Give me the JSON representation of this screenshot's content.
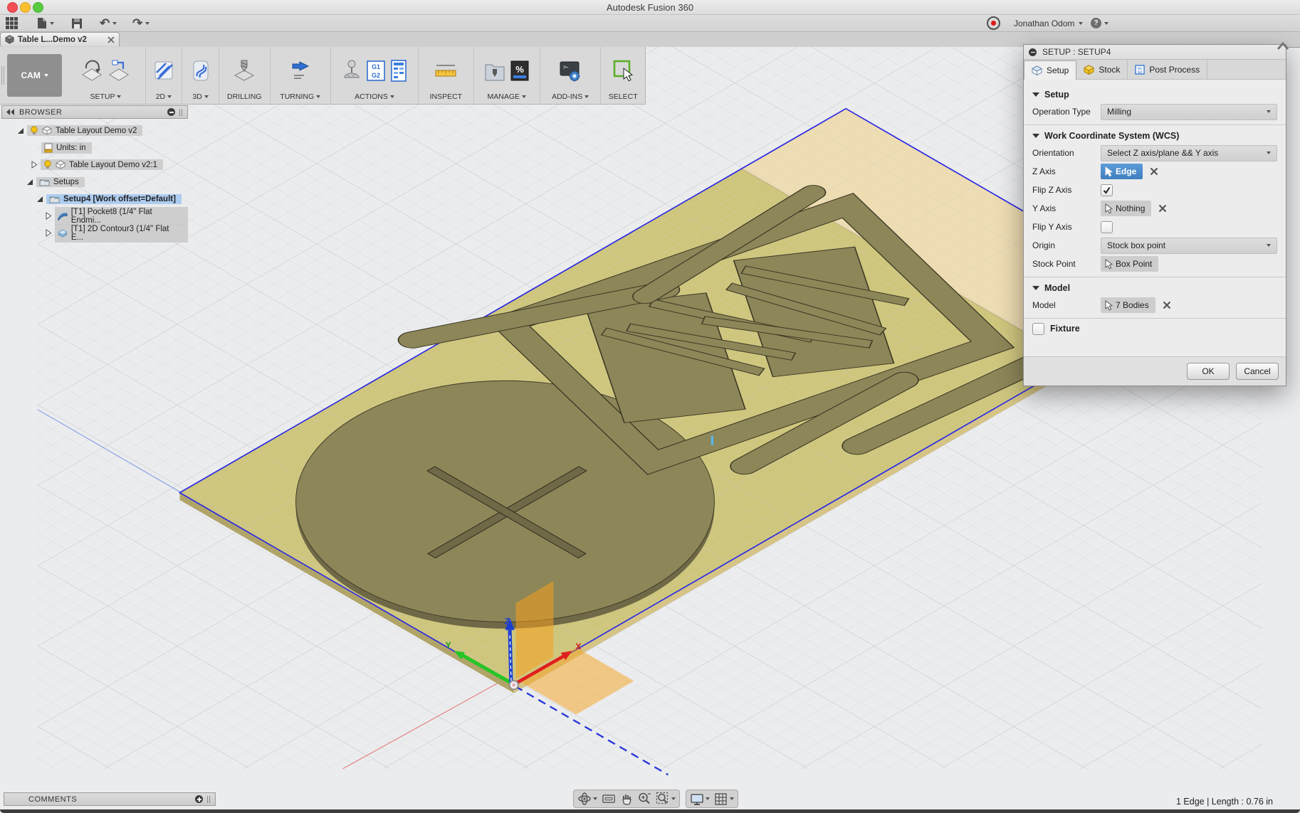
{
  "titlebar": {
    "title": "Autodesk Fusion 360"
  },
  "toolbar": {
    "user": "Jonathan Odom",
    "help": "?"
  },
  "tab": {
    "label": "Table L...Demo v2"
  },
  "ribbon": {
    "cam_label": "CAM",
    "icon_g1": "G1",
    "icon_g2": "G2",
    "icon_percent": "%",
    "icon_prompt": ">-",
    "groups": [
      {
        "label": "SETUP"
      },
      {
        "label": "2D"
      },
      {
        "label": "3D"
      },
      {
        "label": "DRILLING"
      },
      {
        "label": "TURNING"
      },
      {
        "label": "ACTIONS"
      },
      {
        "label": "INSPECT"
      },
      {
        "label": "MANAGE"
      },
      {
        "label": "ADD-INS"
      },
      {
        "label": "SELECT"
      }
    ]
  },
  "browser": {
    "title": "BROWSER",
    "rows": [
      {
        "label": "Table Layout Demo v2"
      },
      {
        "label": "Units: in"
      },
      {
        "label": "Table Layout Demo v2:1"
      },
      {
        "label": "Setups"
      },
      {
        "label": "Setup4 [Work offset=Default]"
      },
      {
        "label": "[T1] Pocket8 (1/4\" Flat Endmi..."
      },
      {
        "label": "[T1] 2D Contour3 (1/4\" Flat E..."
      }
    ]
  },
  "comments": {
    "title": "COMMENTS"
  },
  "canvas": {
    "axes": {
      "x": "X",
      "y": "Y",
      "z": "Z"
    }
  },
  "statusbar": {
    "selection": "1 Edge | Length : 0.76 in"
  },
  "dialog": {
    "title": "SETUP : SETUP4",
    "tabs": [
      {
        "label": "Setup"
      },
      {
        "label": "Stock"
      },
      {
        "label": "Post Process"
      }
    ],
    "setup_section": {
      "title": "Setup",
      "operation_type_label": "Operation Type",
      "operation_type_value": "Milling"
    },
    "wcs_section": {
      "title": "Work Coordinate System (WCS)",
      "orientation_label": "Orientation",
      "orientation_value": "Select Z axis/plane && Y axis",
      "z_axis_label": "Z Axis",
      "z_axis_value": "Edge",
      "flip_z_label": "Flip Z Axis",
      "y_axis_label": "Y Axis",
      "y_axis_value": "Nothing",
      "flip_y_label": "Flip Y Axis",
      "origin_label": "Origin",
      "origin_value": "Stock box point",
      "stock_point_label": "Stock Point",
      "stock_point_value": "Box Point"
    },
    "model_section": {
      "title": "Model",
      "model_label": "Model",
      "model_value": "7 Bodies"
    },
    "fixture_label": "Fixture",
    "footer": {
      "ok": "OK",
      "cancel": "Cancel"
    }
  }
}
